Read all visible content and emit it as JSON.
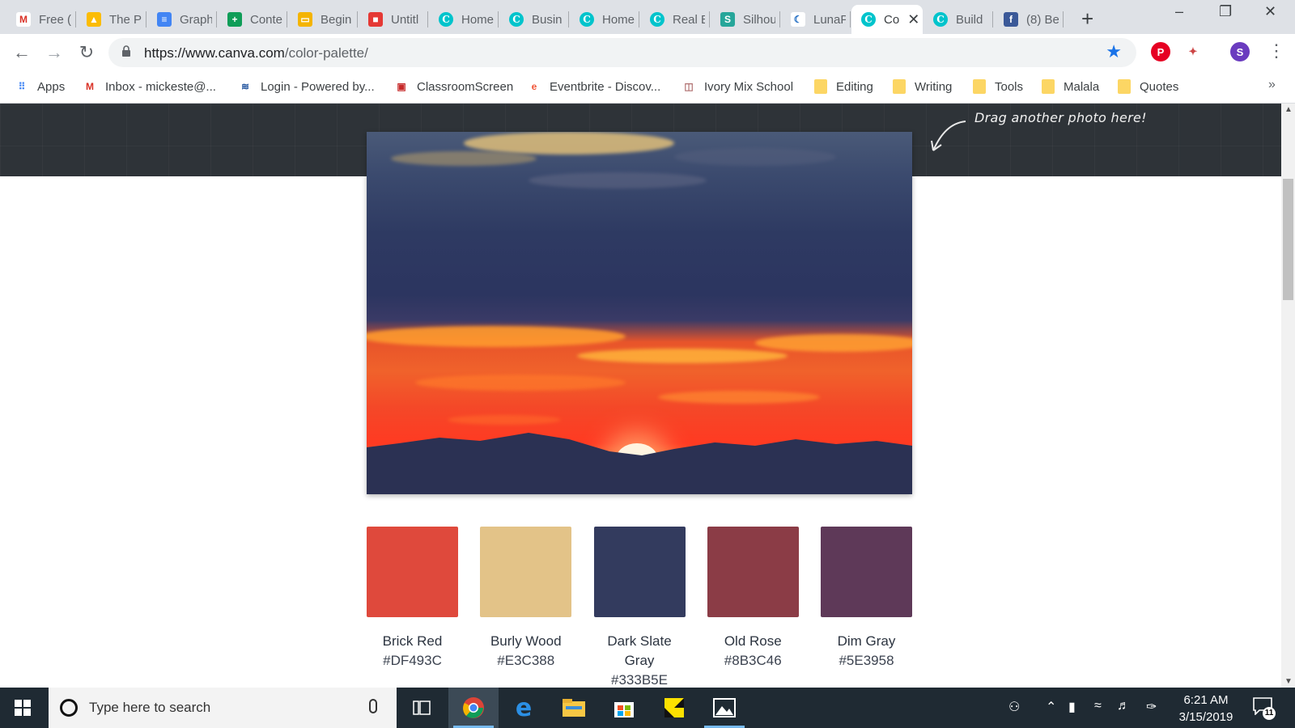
{
  "browser": {
    "tabs": [
      {
        "title": "Free (",
        "icon": "gmail-icon"
      },
      {
        "title": "The P",
        "icon": "google-drive-icon"
      },
      {
        "title": "Graph",
        "icon": "google-docs-icon"
      },
      {
        "title": "Conte",
        "icon": "google-sheets-icon"
      },
      {
        "title": "Begin",
        "icon": "google-slides-icon"
      },
      {
        "title": "Untitl",
        "icon": "red-app-icon"
      },
      {
        "title": "Home",
        "icon": "canva-icon"
      },
      {
        "title": "Busin",
        "icon": "canva-icon"
      },
      {
        "title": "Home",
        "icon": "canva-icon"
      },
      {
        "title": "Real E",
        "icon": "canva-icon"
      },
      {
        "title": "Silhou",
        "icon": "teal-app-icon"
      },
      {
        "title": "LunaP",
        "icon": "luna-icon"
      },
      {
        "title": "Co",
        "icon": "canva-icon",
        "active": true
      },
      {
        "title": "Build",
        "icon": "canva-icon"
      },
      {
        "title": "(8) Be",
        "icon": "facebook-icon"
      }
    ],
    "url_domain": "https://www.canva.com",
    "url_path": "/color-palette/",
    "profile_initial": "S",
    "bookmarks": [
      {
        "label": "Apps",
        "icon": "apps-grid-icon"
      },
      {
        "label": "Inbox - mickeste@...",
        "icon": "gmail-icon"
      },
      {
        "label": "Login - Powered by...",
        "icon": "login-icon"
      },
      {
        "label": "ClassroomScreen",
        "icon": "classroomscreen-icon"
      },
      {
        "label": "Eventbrite - Discov...",
        "icon": "eventbrite-icon"
      },
      {
        "label": "Ivory Mix School",
        "icon": "ivory-mix-icon"
      },
      {
        "label": "Editing",
        "icon": "folder-icon"
      },
      {
        "label": "Writing",
        "icon": "folder-icon"
      },
      {
        "label": "Tools",
        "icon": "folder-icon"
      },
      {
        "label": "Malala",
        "icon": "folder-icon"
      },
      {
        "label": "Quotes",
        "icon": "folder-icon"
      }
    ],
    "more_glyph": "»"
  },
  "page": {
    "hint": "Drag another photo here!",
    "palette": [
      {
        "name": "Brick Red",
        "hex": "#DF493C"
      },
      {
        "name": "Burly Wood",
        "hex": "#E3C388"
      },
      {
        "name": "Dark Slate Gray",
        "hex": "#333B5E"
      },
      {
        "name": "Old Rose",
        "hex": "#8B3C46"
      },
      {
        "name": "Dim Gray",
        "hex": "#5E3958"
      }
    ]
  },
  "taskbar": {
    "search_placeholder": "Type here to search",
    "time": "6:21 AM",
    "date": "3/15/2019",
    "notification_count": "11"
  }
}
